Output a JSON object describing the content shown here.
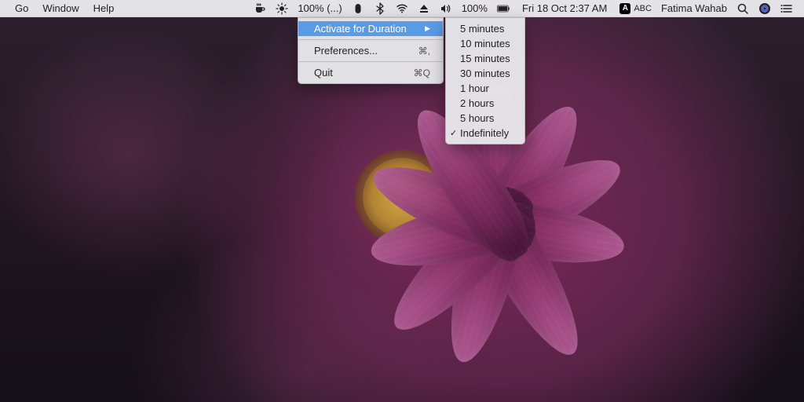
{
  "menubar": {
    "left": {
      "items": [
        {
          "label": "Go"
        },
        {
          "label": "Window"
        },
        {
          "label": "Help"
        }
      ]
    },
    "right": {
      "brightness_text": "100% (...)",
      "battery_text": "100%",
      "datetime": "Fri 18 Oct  2:37 AM",
      "input_abc": "ABC",
      "user": "Fatima Wahab"
    }
  },
  "amphetamine_menu": {
    "activate": "Activate for Duration",
    "preferences": "Preferences...",
    "preferences_shortcut": "⌘,",
    "quit": "Quit",
    "quit_shortcut": "⌘Q",
    "durations": [
      "5 minutes",
      "10 minutes",
      "15 minutes",
      "30 minutes",
      "1 hour",
      "2 hours",
      "5 hours",
      "Indefinitely"
    ],
    "checked_index": 7
  }
}
